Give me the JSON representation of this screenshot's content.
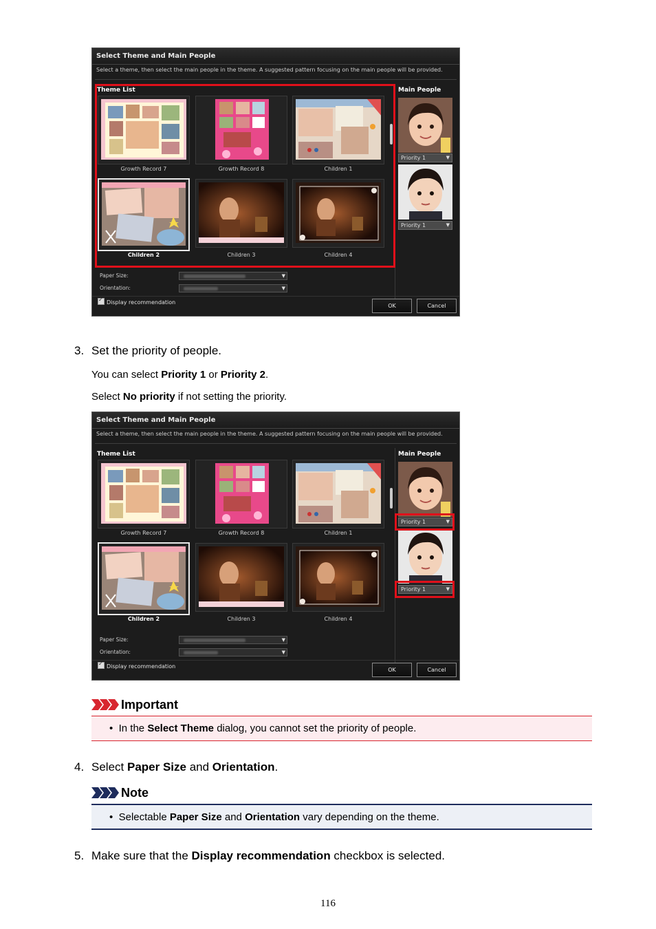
{
  "dialog": {
    "title": "Select Theme and Main People",
    "description": "Select a theme, then select the main people in the theme. A suggested pattern focusing on the main people will be provided.",
    "theme_list_label": "Theme List",
    "main_people_label": "Main People",
    "themes": [
      {
        "name": "Growth Record 7"
      },
      {
        "name": "Growth Record 8"
      },
      {
        "name": "Children 1"
      },
      {
        "name": "Children 2"
      },
      {
        "name": "Children 3"
      },
      {
        "name": "Children 4"
      }
    ],
    "people": [
      {
        "priority": "Priority 1"
      },
      {
        "priority": "Priority 1"
      }
    ],
    "paper_size_label": "Paper Size:",
    "orientation_label": "Orientation:",
    "display_recommendation_label": "Display recommendation",
    "ok_label": "OK",
    "cancel_label": "Cancel",
    "dropdown_arrow": "▼"
  },
  "steps": [
    {
      "number": "3.",
      "text": "Set the priority of people."
    },
    {
      "number": "4.",
      "pre": "Select ",
      "bold1": "Paper Size",
      "mid": " and ",
      "bold2": "Orientation",
      "post": "."
    },
    {
      "number": "5.",
      "pre": "Make sure that the ",
      "bold1": "Display recommendation",
      "post": " checkbox is selected."
    }
  ],
  "step3_para1": {
    "pre": "You can select ",
    "b1": "Priority 1",
    "mid": " or ",
    "b2": "Priority 2",
    "post": "."
  },
  "step3_para2": {
    "pre": "Select ",
    "b1": "No priority",
    "post": " if not setting the priority."
  },
  "important": {
    "title": "Important",
    "bullet": "•",
    "pre": "In the ",
    "bold": "Select Theme",
    "post": " dialog, you cannot set the priority of people."
  },
  "note": {
    "title": "Note",
    "bullet": "•",
    "pre": "Selectable ",
    "bold1": "Paper Size",
    "mid": " and ",
    "bold2": "Orientation",
    "post": " vary depending on the theme."
  },
  "page_number": "116",
  "colors": {
    "important_red": "#d8262f",
    "note_navy": "#1e2c5c",
    "highlight_red": "#e0101a"
  }
}
